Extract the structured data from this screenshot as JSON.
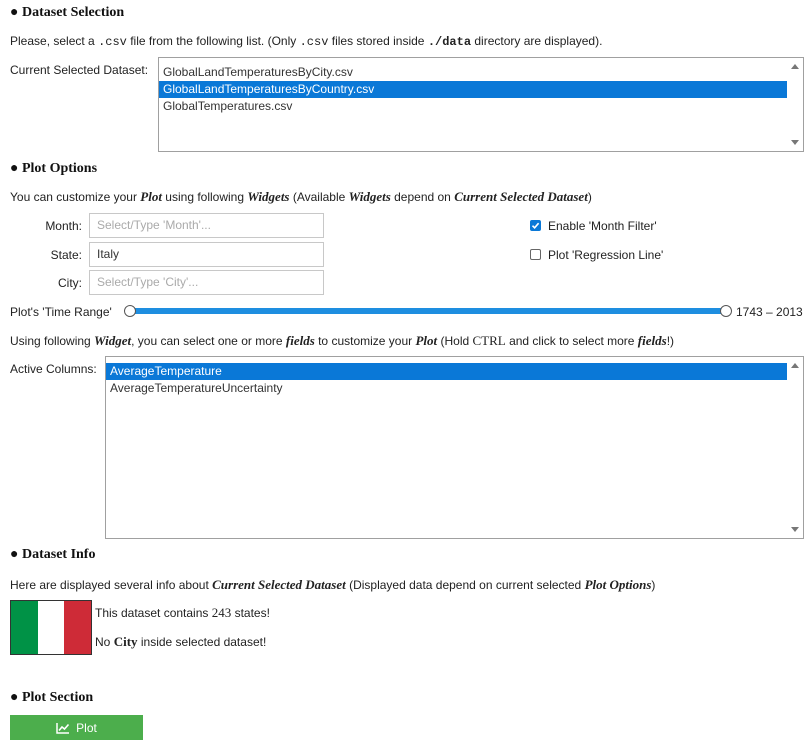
{
  "dataset_selection": {
    "title": "Dataset Selection",
    "desc_pre": "Please, select a ",
    "desc_code1": ".csv",
    "desc_mid": " file from the following list. (Only ",
    "desc_code2": ".csv",
    "desc_mid2": " files stored inside ",
    "desc_code3": "./data",
    "desc_post": " directory are displayed).",
    "label": "Current Selected Dataset:",
    "files": [
      "GlobalLandTemperaturesByCity.csv",
      "GlobalLandTemperaturesByCountry.csv",
      "GlobalTemperatures.csv"
    ],
    "selected_index": 1
  },
  "plot_options": {
    "title": "Plot Options",
    "intro": {
      "t1": "You can customize your ",
      "b1": "Plot",
      "t2": " using following ",
      "b2": "Widgets",
      "t3": " (Available ",
      "b3": "Widgets",
      "t4": " depend on ",
      "b4": "Current Selected Dataset",
      "t5": ")"
    },
    "month": {
      "label": "Month:",
      "value": "",
      "placeholder": "Select/Type 'Month'..."
    },
    "state": {
      "label": "State:",
      "value": "Italy",
      "placeholder": ""
    },
    "city": {
      "label": "City:",
      "value": "",
      "placeholder": "Select/Type 'City'..."
    },
    "enable_month_filter": {
      "label": "Enable 'Month Filter'",
      "checked": true
    },
    "regression_line": {
      "label": "Plot 'Regression Line'",
      "checked": false
    },
    "time_range": {
      "label": "Plot's 'Time Range'",
      "min": 1743,
      "max": 2013,
      "display": "1743 – 2013"
    },
    "fields_intro": {
      "t1": "Using following ",
      "b1": "Widget",
      "t2": ", you can select one or more ",
      "b2": "fields",
      "t3": " to customize your ",
      "b3": "Plot",
      "t4": " (Hold ",
      "c1": "CTRL",
      "t5": " and click to select more ",
      "b4": "fields",
      "t6": "!)"
    },
    "active_columns_label": "Active Columns:",
    "columns": [
      "AverageTemperature",
      "AverageTemperatureUncertainty"
    ],
    "selected_column_index": 0
  },
  "dataset_info": {
    "title": "Dataset Info",
    "intro": {
      "t1": "Here are displayed several info about ",
      "b1": "Current Selected Dataset",
      "t2": " (Displayed data depend on current selected ",
      "b2": "Plot Options",
      "t3": ")"
    },
    "flag_colors": [
      "#009246",
      "#ffffff",
      "#ce2b37"
    ],
    "line1_pre": "This dataset contains ",
    "line1_num": "243",
    "line1_post": " states!",
    "line2_pre": "No ",
    "line2_bold": "City",
    "line2_post": " inside selected dataset!"
  },
  "plot_section": {
    "title": "Plot Section",
    "button_label": "Plot",
    "button_icon": "line-chart-icon",
    "button_color": "#4cae4c"
  },
  "colors": {
    "selection": "#0a78d7",
    "slider": "#1e8ee0"
  }
}
